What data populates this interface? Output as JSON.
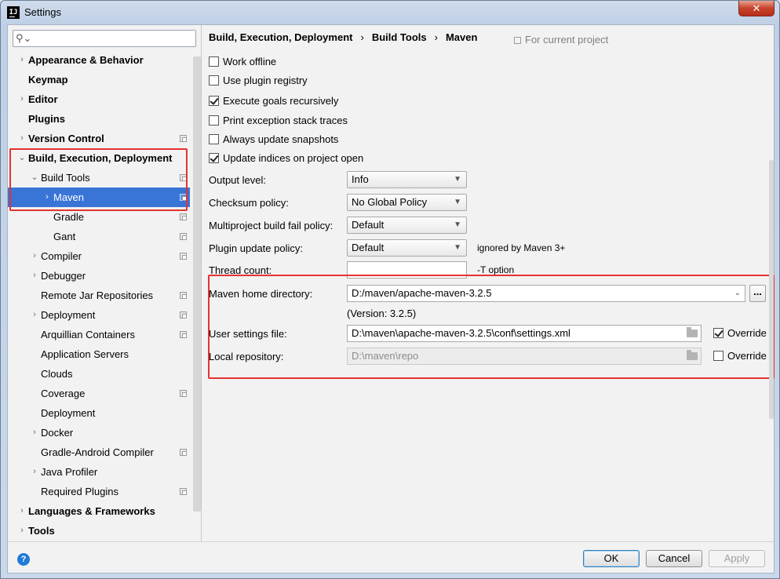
{
  "window": {
    "title": "Settings",
    "close_label": "✕"
  },
  "search": {
    "placeholder": "",
    "value": ""
  },
  "tree": [
    {
      "label": "Appearance & Behavior",
      "bold": true,
      "arrow": "›"
    },
    {
      "label": "Keymap",
      "bold": true,
      "arrow": ""
    },
    {
      "label": "Editor",
      "bold": true,
      "arrow": "›"
    },
    {
      "label": "Plugins",
      "bold": true,
      "arrow": ""
    },
    {
      "label": "Version Control",
      "bold": true,
      "arrow": "›"
    },
    {
      "label": "Build, Execution, Deployment",
      "bold": true,
      "arrow": "⌄"
    },
    {
      "label": "Build Tools",
      "bold": false,
      "arrow": "⌄"
    },
    {
      "label": "Maven",
      "bold": false,
      "arrow": "›",
      "selected": true
    },
    {
      "label": "Gradle",
      "bold": false,
      "arrow": ""
    },
    {
      "label": "Gant",
      "bold": false,
      "arrow": ""
    },
    {
      "label": "Compiler",
      "bold": false,
      "arrow": "›"
    },
    {
      "label": "Debugger",
      "bold": false,
      "arrow": "›"
    },
    {
      "label": "Remote Jar Repositories",
      "bold": false,
      "arrow": ""
    },
    {
      "label": "Deployment",
      "bold": false,
      "arrow": "›"
    },
    {
      "label": "Arquillian Containers",
      "bold": false,
      "arrow": ""
    },
    {
      "label": "Application Servers",
      "bold": false,
      "arrow": ""
    },
    {
      "label": "Clouds",
      "bold": false,
      "arrow": ""
    },
    {
      "label": "Coverage",
      "bold": false,
      "arrow": ""
    },
    {
      "label": "Deployment",
      "bold": false,
      "arrow": ""
    },
    {
      "label": "Docker",
      "bold": false,
      "arrow": "›"
    },
    {
      "label": "Gradle-Android Compiler",
      "bold": false,
      "arrow": ""
    },
    {
      "label": "Java Profiler",
      "bold": false,
      "arrow": "›"
    },
    {
      "label": "Required Plugins",
      "bold": false,
      "arrow": ""
    },
    {
      "label": "Languages & Frameworks",
      "bold": true,
      "arrow": "›"
    },
    {
      "label": "Tools",
      "bold": true,
      "arrow": "›"
    }
  ],
  "breadcrumb": {
    "part1": "Build, Execution, Deployment",
    "part2": "Build Tools",
    "part3": "Maven",
    "sep": "›",
    "scope": "For current project"
  },
  "options": {
    "work_offline": {
      "label": "Work offline",
      "checked": false
    },
    "use_plugin_registry": {
      "label": "Use plugin registry",
      "checked": false
    },
    "execute_goals_recursively": {
      "label": "Execute goals recursively",
      "checked": true
    },
    "print_exception_stack_traces": {
      "label": "Print exception stack traces",
      "checked": false
    },
    "always_update_snapshots": {
      "label": "Always update snapshots",
      "checked": false
    },
    "update_indices_on_project_open": {
      "label": "Update indices on project open",
      "checked": true
    }
  },
  "fields": {
    "output_level": {
      "label": "Output level:",
      "value": "Info"
    },
    "checksum_policy": {
      "label": "Checksum policy:",
      "value": "No Global Policy"
    },
    "multiproject_fail_policy": {
      "label": "Multiproject build fail policy:",
      "value": "Default"
    },
    "plugin_update_policy": {
      "label": "Plugin update policy:",
      "value": "Default",
      "hint": "ignored by Maven 3+"
    },
    "thread_count": {
      "label": "Thread count:",
      "value": "",
      "hint": "-T option"
    },
    "maven_home": {
      "label": "Maven home directory:",
      "value": "D:/maven/apache-maven-3.2.5",
      "version": "(Version: 3.2.5)",
      "browse": "..."
    },
    "user_settings": {
      "label": "User settings file:",
      "value": "D:\\maven\\apache-maven-3.2.5\\conf\\settings.xml",
      "override_label": "Override",
      "override": true
    },
    "local_repo": {
      "label": "Local repository:",
      "value": "D:\\maven\\repo",
      "override_label": "Override",
      "override": false
    }
  },
  "buttons": {
    "ok": "OK",
    "cancel": "Cancel",
    "apply": "Apply",
    "help": "?"
  },
  "colors": {
    "selection": "#3875d7",
    "highlight_box": "#e53232"
  }
}
